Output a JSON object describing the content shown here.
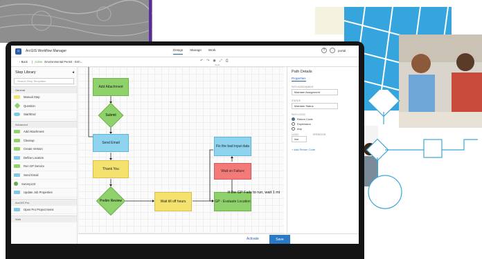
{
  "app": {
    "title": "ArcGIS Workflow Manager",
    "logo_icon": "arcgis-logo-icon"
  },
  "topnav": {
    "items": [
      "Design",
      "Manage",
      "Work"
    ],
    "active": "Design"
  },
  "topbar": {
    "user_label": "portal"
  },
  "crumbs": {
    "back": "Back",
    "status": "Active",
    "name": "Environmental Permit - Enh..."
  },
  "tools": {
    "label": "Tools"
  },
  "step_library": {
    "title": "Step Library",
    "search_placeholder": "Search Step Templates",
    "groups": [
      {
        "name": "General",
        "items": [
          {
            "label": "Manual Step",
            "shape": "yellow"
          },
          {
            "label": "Question",
            "shape": "diamond"
          },
          {
            "label": "Start/End",
            "shape": "oval"
          }
        ]
      },
      {
        "name": "Advanced",
        "items": [
          {
            "label": "Add Attachment",
            "shape": "green"
          },
          {
            "label": "Cleanup",
            "shape": "green"
          },
          {
            "label": "Create Version",
            "shape": "green"
          },
          {
            "label": "Define Location",
            "shape": "blue"
          },
          {
            "label": "Run GP Service",
            "shape": "green"
          },
          {
            "label": "Send Email",
            "shape": "blue"
          },
          {
            "label": "Survey123",
            "shape": "darkgreen"
          },
          {
            "label": "Update Job Properties",
            "shape": "blue"
          }
        ]
      },
      {
        "name": "ArcGIS Pro",
        "items": [
          {
            "label": "Open Pro Project Items",
            "shape": "blue"
          }
        ]
      },
      {
        "name": "Web",
        "items": []
      }
    ]
  },
  "canvas": {
    "nodes": {
      "add_attachment": "Add Attachment",
      "submit": "Submit",
      "send_email": "Send Email",
      "thank_you": "Thank You",
      "prelim_review": "Prelim Review",
      "wait_till_off_hours": "Wait till off hours",
      "gp_evaluate": "GP - Evaluate Location",
      "wait_on_failure": "Wait on Failure",
      "fix_bad_input": "Fix the bad input data"
    },
    "failure_note": "If the GP Fails to run, wait 1 mi"
  },
  "path_details": {
    "title": "Path Details",
    "tab": "Properties",
    "path_assignment_label": "PATH ASSIGNMENT",
    "path_assignment_value": "Maintain Assignment",
    "status_label": "STATUS",
    "status_value": "Maintain Status",
    "path_logic_label": "PATH LOGIC",
    "options": [
      "Return Code",
      "Expression",
      "Any"
    ],
    "selected": "Return Code",
    "logic_label": "LOGIC",
    "operator_label": "OPERATOR",
    "logic_value": "line",
    "add_return_code": "Add Return Code"
  },
  "bottom": {
    "activate": "Activate",
    "save": "Save"
  },
  "colors": {
    "accent": "#2a79c6",
    "step_green": "#8fd16b",
    "step_blue": "#8ed4ef",
    "step_yellow": "#f4e16e",
    "step_red": "#f47a7a",
    "purple": "#5a2aa0"
  }
}
